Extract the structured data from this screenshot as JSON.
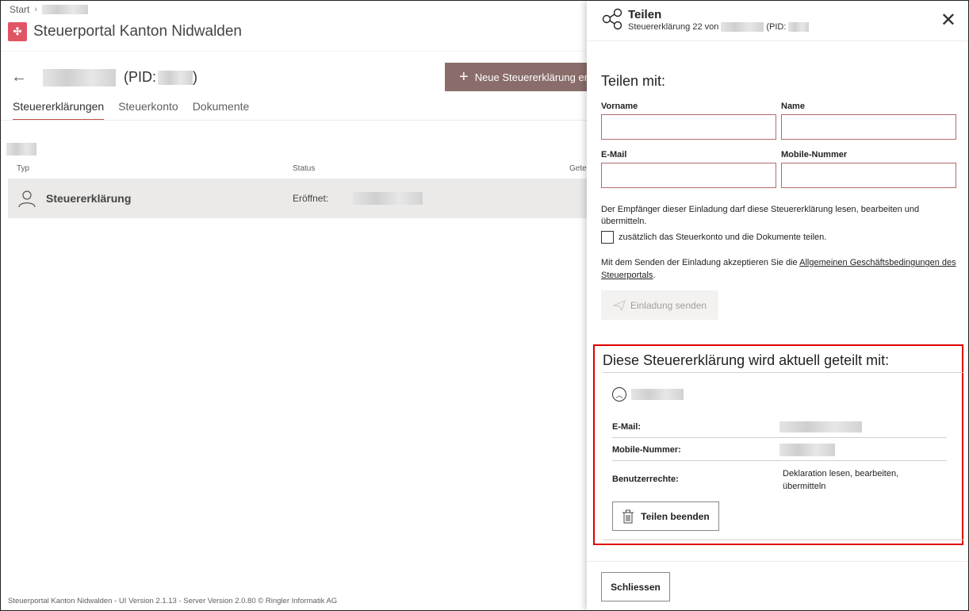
{
  "breadcrumb": {
    "start": "Start"
  },
  "app": {
    "title": "Steuerportal Kanton Nidwalden"
  },
  "page": {
    "pid_label": "(PID:",
    "pid_close": ")"
  },
  "toolbar": {
    "new_label": "Neue Steuererklärung eröf"
  },
  "tabs": [
    {
      "label": "Steuererklärungen"
    },
    {
      "label": "Steuerkonto"
    },
    {
      "label": "Dokumente"
    }
  ],
  "table": {
    "columns": {
      "type": "Typ",
      "status": "Status",
      "third": "Getei"
    },
    "row": {
      "type": "Steuererklärung",
      "status": "Eröffnet:"
    }
  },
  "footer": {
    "text": "Steuerportal Kanton Nidwalden - UI Version 2.1.13 - Server Version 2.0.80 © Ringler Informatik AG"
  },
  "panel": {
    "title": "Teilen",
    "subtitle_prefix": "Steuererklärung 22 von",
    "subtitle_pid": "(PID:",
    "close_glyph": "✕",
    "share_with": "Teilen mit:",
    "fields": {
      "vorname": "Vorname",
      "name": "Name",
      "email": "E-Mail",
      "mobile": "Mobile-Nummer"
    },
    "info": "Der Empfänger dieser Einladung darf diese Steuererklärung lesen, bearbeiten und übermitteln.",
    "checkbox_label": "zusätzlich das Steuerkonto und die Dokumente teilen.",
    "agb_prefix": "Mit dem Senden der Einladung akzeptieren Sie die ",
    "agb_link": "Allgemeinen Geschäftsbedingungen des Steuerportals",
    "agb_suffix": ".",
    "send_label": "Einladung senden",
    "shared": {
      "title": "Diese Steuererklärung wird aktuell geteilt mit:",
      "email_label": "E-Mail:",
      "mobile_label": "Mobile-Nummer:",
      "rights_label": "Benutzerrechte:",
      "rights_value": "Deklaration lesen, bearbeiten, übermitteln",
      "end_label": "Teilen beenden"
    },
    "close_label": "Schliessen"
  },
  "colors": {
    "accent": "#c1504c",
    "button_bg": "#8a6d6a",
    "highlight": "#e00000",
    "logo": "#e05564"
  }
}
